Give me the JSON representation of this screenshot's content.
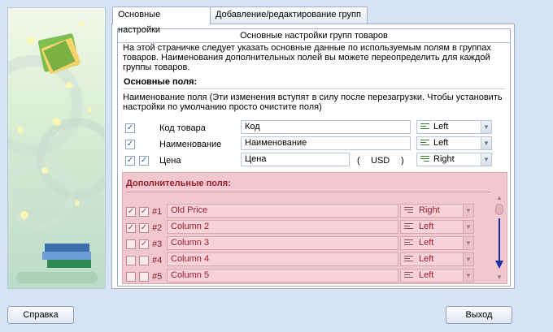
{
  "tabs": [
    {
      "label": "Основные настройки"
    },
    {
      "label": "Добавление/редактирование групп"
    }
  ],
  "header": {
    "title": "Основные настройки групп товаров",
    "description": "На этой страничке следует указать основные данные по используемым полям в группах товаров. Наименования дополнительных полей вы можете переопределить для каждой группы товаров."
  },
  "main_fields": {
    "title": "Основные поля:",
    "note": "Наименование поля (Эти изменения вступят в силу после перезагрузки. Чтобы установить настройки по умолчанию просто очистите поля)",
    "rows": [
      {
        "label": "Код товара",
        "value": "Код",
        "align": "Left"
      },
      {
        "label": "Наименование",
        "value": "Наименование",
        "align": "Left"
      },
      {
        "label": "Цена",
        "value": "Цена",
        "align": "Right",
        "currency_open": "(",
        "currency": "USD",
        "currency_close": ")"
      }
    ]
  },
  "extra_fields": {
    "title": "Дополнительные поля:",
    "rows": [
      {
        "num": "#1",
        "value": "Old Price",
        "align": "Right"
      },
      {
        "num": "#2",
        "value": "Column 2",
        "align": "Left"
      },
      {
        "num": "#3",
        "value": "Column 3",
        "align": "Left"
      },
      {
        "num": "#4",
        "value": "Column 4",
        "align": "Left"
      },
      {
        "num": "#5",
        "value": "Column 5",
        "align": "Left"
      }
    ]
  },
  "buttons": {
    "help": "Справка",
    "exit": "Выход"
  }
}
